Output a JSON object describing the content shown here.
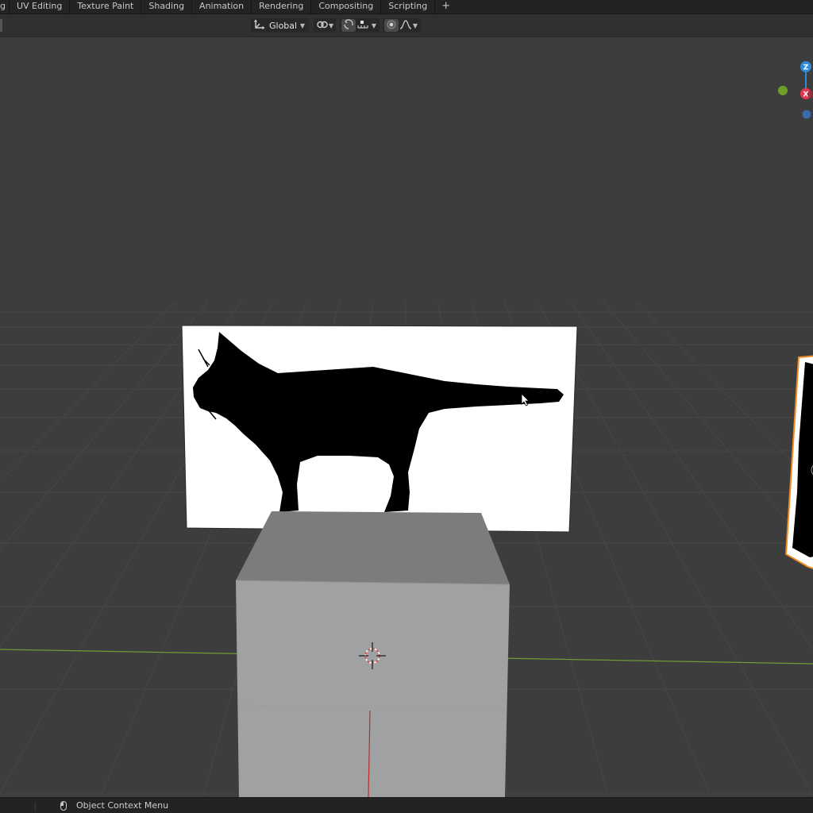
{
  "workspace_tabs": [
    {
      "label": "g"
    },
    {
      "label": "UV Editing"
    },
    {
      "label": "Texture Paint"
    },
    {
      "label": "Shading"
    },
    {
      "label": "Animation"
    },
    {
      "label": "Rendering"
    },
    {
      "label": "Compositing"
    },
    {
      "label": "Scripting"
    },
    {
      "label": "+"
    }
  ],
  "header": {
    "transform_orientation": "Global",
    "snap_active": true,
    "proportional_editing": false
  },
  "viewport": {
    "background": "#3d3d3d",
    "axis_x_color": "#7fb33a",
    "axis_z_color": "#c0392b",
    "gizmo": {
      "z_label": "Z",
      "x_label": "X",
      "z_color": "#2e8bd8",
      "x_color": "#e8384f",
      "y_color": "#6d9e2a",
      "neg_z_color": "#3a6aa8"
    },
    "objects": [
      {
        "name": "cat-reference-plane",
        "image": "cat-silhouette"
      },
      {
        "name": "cube",
        "color": "#a0a1a2"
      },
      {
        "name": "selected-plane",
        "outline": "#f08a24"
      }
    ]
  },
  "statusbar": {
    "mouse_icon": "mouse-right-click-icon",
    "text": "Object Context Menu"
  }
}
